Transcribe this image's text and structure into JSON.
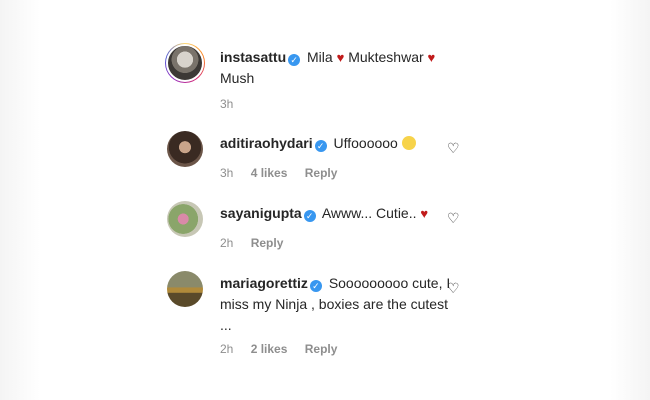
{
  "caption": {
    "username": "instasattu",
    "text_parts": [
      "Mila",
      "Mukteshwar",
      "Mush"
    ],
    "time": "3h"
  },
  "comments": [
    {
      "username": "aditiraohydari",
      "text": "Uffoooooo",
      "emoji": "astonished-face-icon",
      "time": "3h",
      "likes": "4 likes",
      "reply": "Reply"
    },
    {
      "username": "sayanigupta",
      "text": "Awww... Cutie..",
      "emoji": "red-heart-icon",
      "time": "2h",
      "reply": "Reply"
    },
    {
      "username": "mariagorettiz",
      "text": "Sooooooooo cute, I miss my Ninja , boxies are the cutest ...",
      "time": "2h",
      "likes": "2 likes",
      "reply": "Reply"
    }
  ],
  "colors": {
    "text": "#262626",
    "muted": "#8e8e8e",
    "verified": "#3897f0",
    "heart": "#c11b1b"
  }
}
